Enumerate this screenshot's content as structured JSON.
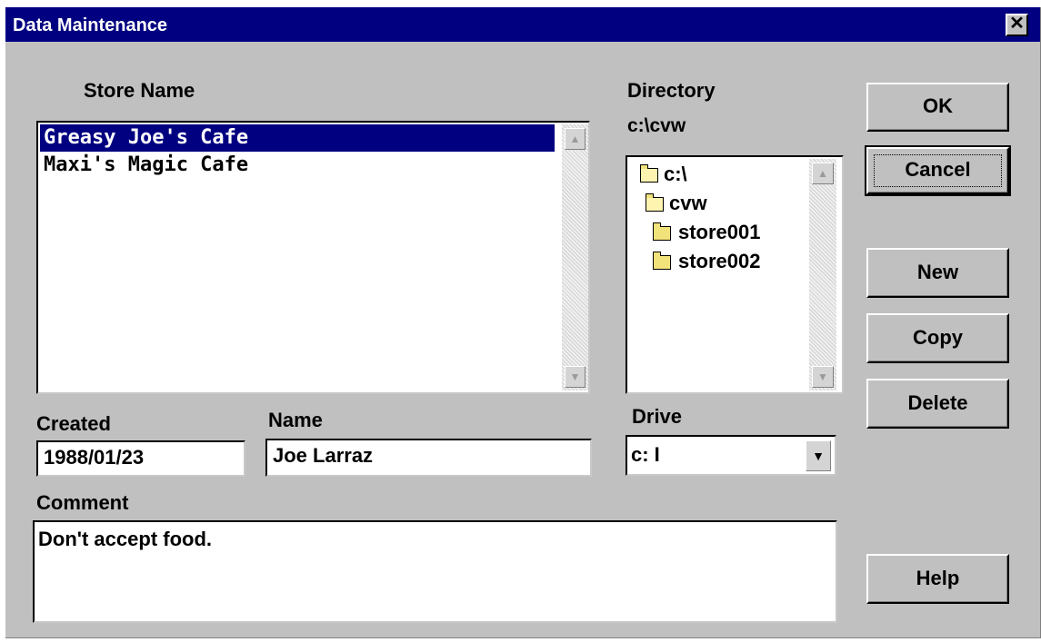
{
  "window": {
    "title": "Data Maintenance",
    "close_glyph": "✕"
  },
  "store_list": {
    "label": "Store Name",
    "items": [
      "Greasy Joe's Cafe",
      "Maxi's Magic Cafe"
    ],
    "selected_index": 0
  },
  "directory": {
    "label": "Directory",
    "current_path": "c:\\cvw",
    "tree": [
      {
        "name": "c:\\",
        "icon": "open-folder-icon"
      },
      {
        "name": "cvw",
        "icon": "open-folder-icon"
      },
      {
        "name": "store001",
        "icon": "folder-icon"
      },
      {
        "name": "store002",
        "icon": "folder-icon"
      }
    ]
  },
  "fields": {
    "created_label": "Created",
    "created_value": "1988/01/23",
    "name_label": "Name",
    "name_value": "Joe Larraz",
    "comment_label": "Comment",
    "comment_value": "Don't accept food."
  },
  "drive": {
    "label": "Drive",
    "value": "c: I"
  },
  "buttons": {
    "ok": "OK",
    "cancel": "Cancel",
    "new": "New",
    "copy": "Copy",
    "delete": "Delete",
    "help": "Help"
  },
  "colors": {
    "title_bar": "#000080",
    "face": "#c0c0c0",
    "selection": "#000080"
  }
}
